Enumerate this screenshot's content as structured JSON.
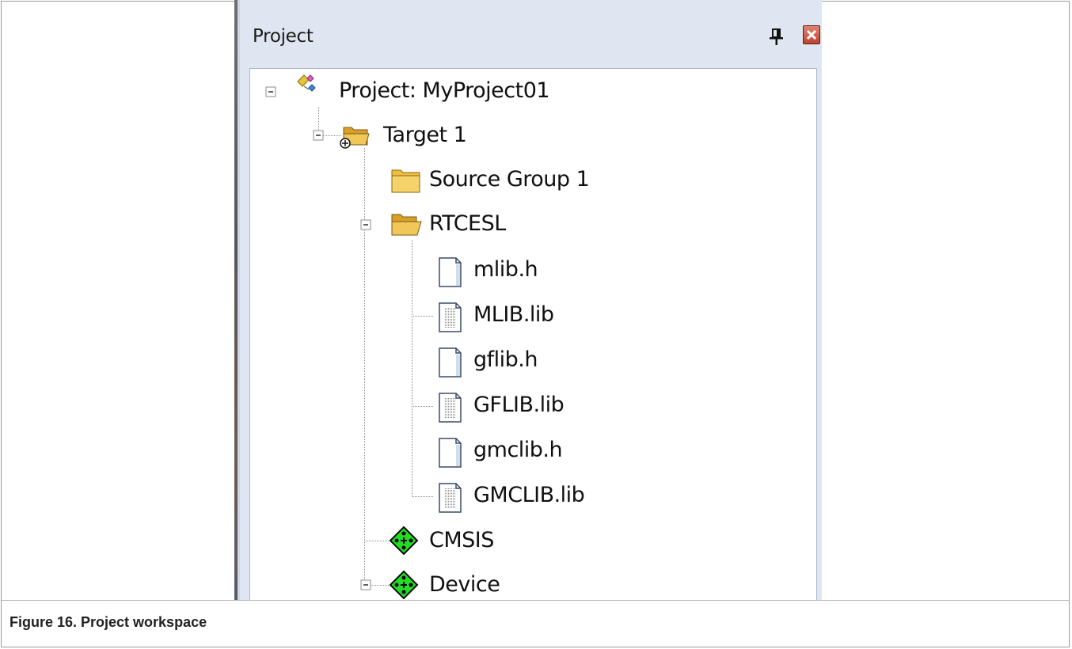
{
  "panel": {
    "title": "Project",
    "pin_icon": "pin-icon",
    "close_icon": "close-icon"
  },
  "tree": {
    "root": {
      "label": "Project: MyProject01",
      "icon": "project-icon",
      "expanded": true
    },
    "target": {
      "label": "Target 1",
      "icon": "target-folder-icon",
      "expanded": true
    },
    "source_group": {
      "label": "Source Group 1",
      "icon": "folder-icon"
    },
    "rtcesl": {
      "label": "RTCESL",
      "icon": "open-folder-icon",
      "expanded": true
    },
    "files": [
      {
        "label": "mlib.h",
        "icon": "header-file-icon"
      },
      {
        "label": "MLIB.lib",
        "icon": "library-file-icon"
      },
      {
        "label": "gflib.h",
        "icon": "header-file-icon"
      },
      {
        "label": "GFLIB.lib",
        "icon": "library-file-icon"
      },
      {
        "label": "gmclib.h",
        "icon": "header-file-icon"
      },
      {
        "label": "GMCLIB.lib",
        "icon": "library-file-icon"
      }
    ],
    "cmsis": {
      "label": "CMSIS",
      "icon": "component-icon"
    },
    "device": {
      "label": "Device",
      "icon": "component-icon",
      "expanded": true
    }
  },
  "caption": "Figure 16. Project workspace",
  "colors": {
    "panel_bg": "#dfe6f1",
    "folder_yellow": "#e9b93a",
    "component_green": "#22dd22",
    "close_red": "#c0432e"
  }
}
